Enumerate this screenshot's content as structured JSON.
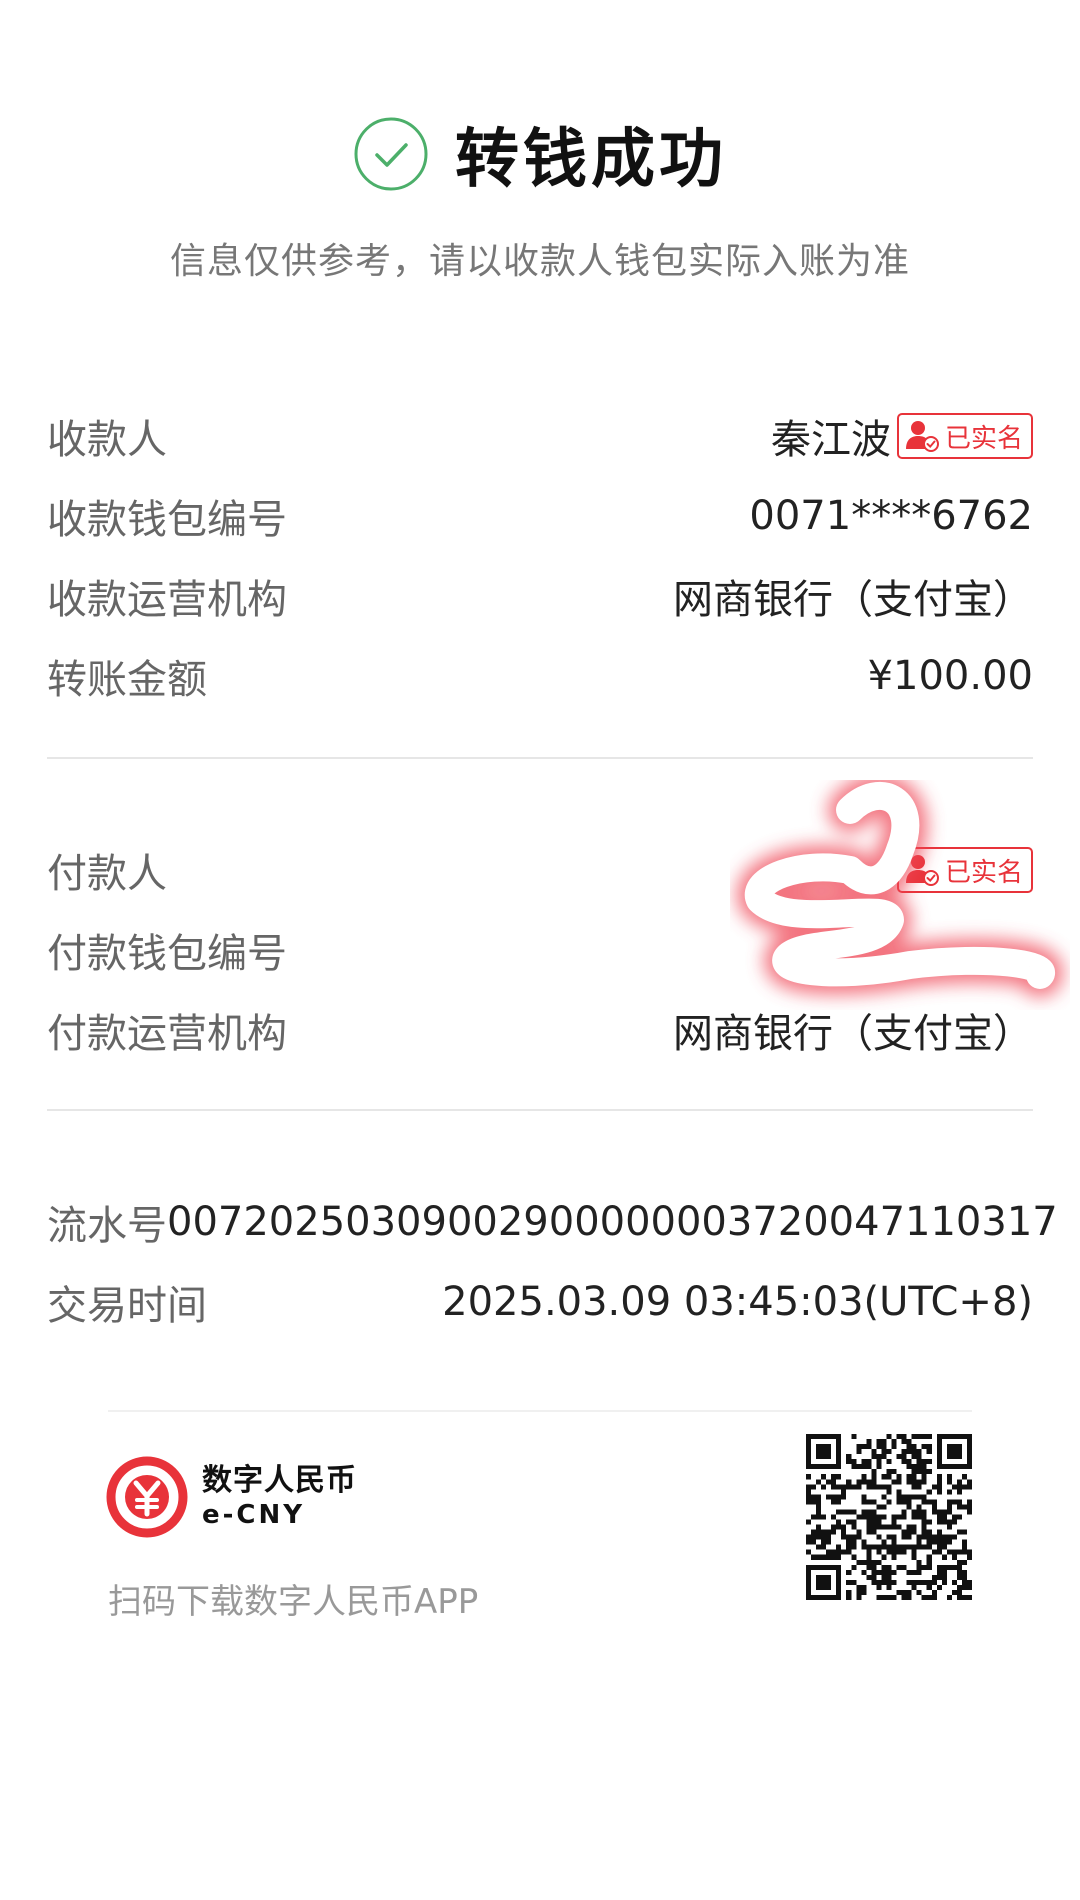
{
  "header": {
    "title": "转钱成功",
    "subtitle": "信息仅供参考，请以收款人钱包实际入账为准",
    "icon": "check-circle-icon",
    "icon_color": "#4caf6a"
  },
  "payee_section": {
    "payee_label": "收款人",
    "payee_value": "秦江波",
    "payee_badge": "已实名",
    "wallet_label": "收款钱包编号",
    "wallet_value": "0071****6762",
    "operator_label": "收款运营机构",
    "operator_value": "网商银行（支付宝）",
    "amount_label": "转账金额",
    "amount_value": "¥100.00"
  },
  "payer_section": {
    "payer_label": "付款人",
    "payer_badge": "已实名",
    "wallet_label": "付款钱包编号",
    "operator_label": "付款运营机构",
    "operator_value": "网商银行（支付宝）"
  },
  "transaction": {
    "serial_label": "流水号",
    "serial_value": "0072025030900290000000372004711031​7",
    "time_label": "交易时间",
    "time_value": "2025.03.09 03:45:03(UTC+8)"
  },
  "footer": {
    "logo_cn": "数字人民币",
    "logo_en": "e-CNY",
    "download_text": "扫码下载数字人民币APP",
    "brand_color": "#e8333a"
  }
}
